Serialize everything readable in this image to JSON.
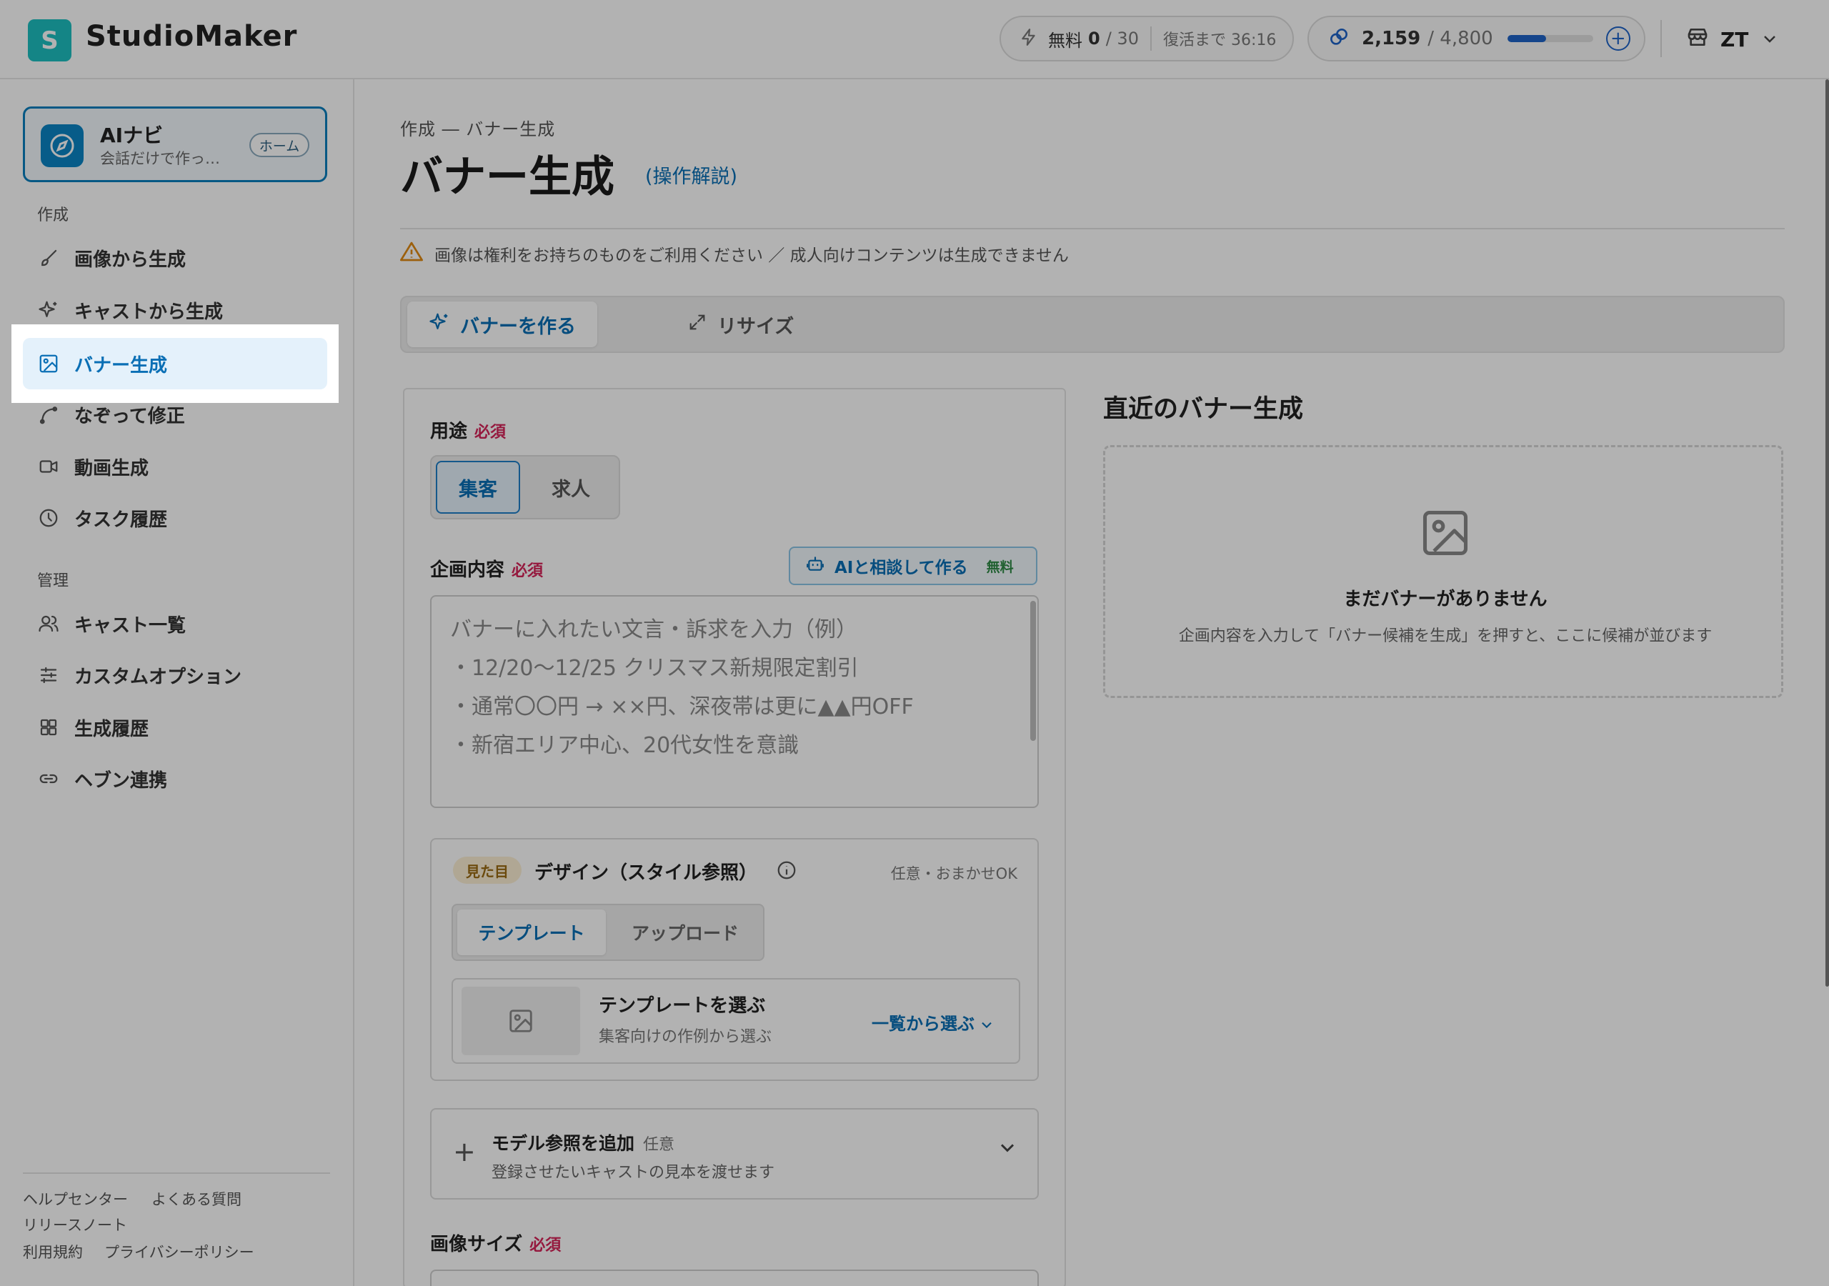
{
  "app": {
    "logo_letter": "S",
    "brand": "StudioMaker"
  },
  "header": {
    "free": {
      "label": "無料",
      "used": "0",
      "total": "/ 30",
      "reset": "復活まで 36:16"
    },
    "points": {
      "current": "2,159",
      "total": "/ 4,800",
      "fraction": 0.45
    },
    "user_initials": "ZT"
  },
  "sidebar": {
    "ainavi": {
      "title": "AIナビ",
      "subtitle": "会話だけで作っ…",
      "badge": "ホーム"
    },
    "section_create": "作成",
    "create_items": [
      {
        "label": "画像から生成",
        "icon": "brush-icon"
      },
      {
        "label": "キャストから生成",
        "icon": "sparkle-icon"
      },
      {
        "label": "バナー生成",
        "icon": "image-icon",
        "active": true
      },
      {
        "label": "なぞって修正",
        "icon": "trace-icon"
      },
      {
        "label": "動画生成",
        "icon": "video-icon"
      },
      {
        "label": "タスク履歴",
        "icon": "clock-icon"
      }
    ],
    "section_manage": "管理",
    "manage_items": [
      {
        "label": "キャスト一覧",
        "icon": "users-icon"
      },
      {
        "label": "カスタムオプション",
        "icon": "sliders-icon"
      },
      {
        "label": "生成履歴",
        "icon": "grid-icon"
      },
      {
        "label": "ヘブン連携",
        "icon": "link-icon"
      }
    ],
    "footer": {
      "help": "ヘルプセンター",
      "faq": "よくある質問",
      "release": "リリースノート",
      "terms": "利用規約",
      "privacy": "プライバシーポリシー"
    }
  },
  "main": {
    "breadcrumb": "作成 ― バナー生成",
    "title": "バナー生成",
    "howto": "(操作解説)",
    "warning": "画像は権利をお持ちのものをご利用ください ／ 成人向けコンテンツは生成できません",
    "tabs": [
      {
        "label": "バナーを作る"
      },
      {
        "label": "リサイズ"
      }
    ],
    "form": {
      "purpose_label": "用途",
      "required": "必須",
      "purpose_options": [
        "集客",
        "求人"
      ],
      "plan_label": "企画内容",
      "ai_button": "AIと相談して作る",
      "ai_free": "無料",
      "placeholder_lines": [
        "バナーに入れたい文言・訴求を入力（例）",
        "・12/20〜12/25 クリスマス新規限定割引",
        "・通常〇〇円 → ××円、深夜帯は更に▲▲円OFF",
        "・新宿エリア中心、20代女性を意識"
      ],
      "design": {
        "badge": "見た目",
        "title": "デザイン（スタイル参照）",
        "optional": "任意・おまかせOK",
        "tabs": [
          "テンプレート",
          "アップロード"
        ],
        "template_title": "テンプレートを選ぶ",
        "template_sub": "集客向けの作例から選ぶ",
        "template_link": "一覧から選ぶ"
      },
      "model": {
        "title": "モデル参照を追加",
        "optional": "任意",
        "sub": "登録させたいキャストの見本を渡せます"
      },
      "size_label": "画像サイズ"
    },
    "recent": {
      "title": "直近のバナー生成",
      "empty_title": "まだバナーがありません",
      "empty_sub": "企画内容を入力して「バナー候補を生成」を押すと、ここに候補が並びます"
    }
  }
}
